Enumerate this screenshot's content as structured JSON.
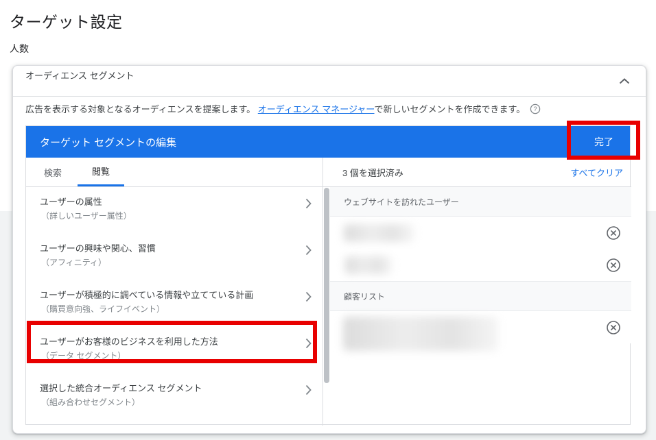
{
  "page": {
    "title": "ターゲット設定",
    "subtitle": "人数"
  },
  "panel": {
    "header": "オーディエンス セグメント",
    "description": {
      "text_before": "広告を表示する対象となるオーディエンスを提案します。 ",
      "link_text": "オーディエンス マネージャー",
      "text_after": "で新しいセグメントを作成できます。",
      "help_icon": "question-mark-in-circle"
    },
    "editor": {
      "title": "ターゲット セグメントの編集",
      "done_label": "完了",
      "tabs": [
        {
          "label": "検索",
          "active": false
        },
        {
          "label": "閲覧",
          "active": true
        }
      ],
      "categories": [
        {
          "label": "ユーザーの属性",
          "sublabel": "（詳しいユーザー属性）",
          "highlighted": false
        },
        {
          "label": "ユーザーの興味や関心、習慣",
          "sublabel": "（アフィニティ）",
          "highlighted": false
        },
        {
          "label": "ユーザーが積極的に調べている情報や立てている計画",
          "sublabel": "（購買意向強、ライフイベント）",
          "highlighted": false
        },
        {
          "label": "ユーザーがお客様のビジネスを利用した方法",
          "sublabel": "（データ セグメント）",
          "highlighted": true
        },
        {
          "label": "選択した統合オーディエンス セグメント",
          "sublabel": "（組み合わせセグメント）",
          "highlighted": false
        }
      ],
      "selection": {
        "count_label": "3 個を選択済み",
        "clear_all_label": "すべてクリア",
        "groups": [
          {
            "header": "ウェブサイトを訪れたユーザー",
            "items": [
              {
                "redacted": true
              },
              {
                "redacted": true
              }
            ]
          },
          {
            "header": "顧客リスト",
            "items": [
              {
                "redacted": true
              }
            ]
          }
        ]
      }
    }
  },
  "colors": {
    "accent_blue": "#1a73e8",
    "annotation_red": "#e80000",
    "text_primary": "#202124",
    "text_secondary": "#5f6368",
    "text_muted": "#80868b",
    "border": "#dadce0",
    "band_bg": "#f8f9fa",
    "page_bg_bottom": "#f1f3f4"
  }
}
